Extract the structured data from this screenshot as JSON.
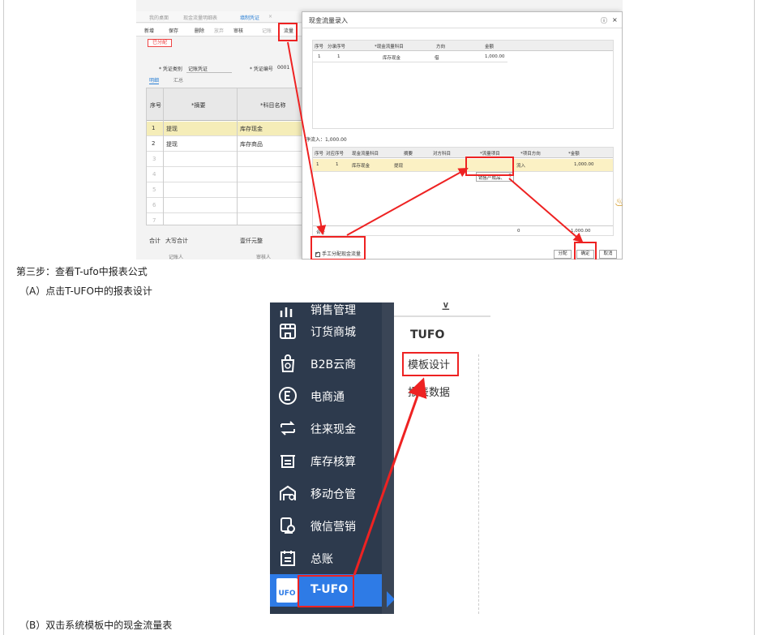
{
  "step3": "第三步：查看T-ufo中报表公式",
  "stepA": "（A）点击T-UFO中的报表设计",
  "stepB": "（B）双击系统模板中的现金流量表",
  "shot1": {
    "tabs": [
      "我的桌面",
      "现金流量明细表",
      "填制凭证"
    ],
    "toolbar": [
      "新增",
      "保存",
      "删除",
      "放弃",
      "审核",
      "记账",
      "流量"
    ],
    "tag": "已分配",
    "voucher_type_label": "* 凭证类别",
    "voucher_type_value": "记账凭证",
    "voucher_no_label": "* 凭证编号",
    "voucher_no_value": "0001",
    "subtabs": [
      "明细",
      "汇总"
    ],
    "table_headers": [
      "序号",
      "*摘要",
      "*科目名称"
    ],
    "rows": [
      {
        "no": "1",
        "summary": "提现",
        "account": "库存现金"
      },
      {
        "no": "2",
        "summary": "提现",
        "account": "库存商品"
      }
    ],
    "empty_rows": [
      "3",
      "4",
      "5",
      "6",
      "7"
    ],
    "footer": {
      "total": "合计",
      "caps_total": "大写合计",
      "caps_value": "壹仟元整",
      "bookkeeper": "记账人",
      "auditor": "审核人"
    },
    "modal": {
      "title": "现金流量录入",
      "help_icon": "?",
      "close_icon": "×",
      "table1_headers": [
        "序号",
        "分录序号",
        "*现金流量科目",
        "方向",
        "金额"
      ],
      "table1_row": {
        "no": "1",
        "entry": "1",
        "account": "库存现金",
        "dir": "借",
        "amount": "1,000.00"
      },
      "net_flow_label": "净流入：",
      "net_flow_value": "1,000.00",
      "table2_headers": [
        "序号",
        "对应序号",
        "现金流量科目",
        "摘要",
        "对方科目",
        "*流量项目",
        "*项目方向",
        "*金额"
      ],
      "table2_row": {
        "no": "1",
        "entry": "1",
        "account": "库存现金",
        "summary": "提现",
        "opp": "",
        "item": "销售产成品、",
        "dir": "流入",
        "amount": "1,000.00"
      },
      "sum_label": "合计",
      "sum_mid": "0",
      "sum_amount": "1,000.00",
      "manual_checkbox": "手工分配现金流量",
      "btn_allocate": "分配",
      "btn_ok": "确定",
      "btn_cancel": "取消"
    }
  },
  "shot2": {
    "nav": [
      {
        "label": "销售管理",
        "icon": "sales-icon"
      },
      {
        "label": "订货商城",
        "icon": "store-icon"
      },
      {
        "label": "B2B云商",
        "icon": "shopping-bag-icon"
      },
      {
        "label": "电商通",
        "icon": "ecommerce-icon"
      },
      {
        "label": "往来现金",
        "icon": "cash-flow-icon"
      },
      {
        "label": "库存核算",
        "icon": "inventory-icon"
      },
      {
        "label": "移动仓管",
        "icon": "warehouse-icon"
      },
      {
        "label": "微信营销",
        "icon": "wechat-marketing-icon"
      },
      {
        "label": "总账",
        "icon": "ledger-icon"
      },
      {
        "label": "T-UFO",
        "icon": "tufo-icon"
      }
    ],
    "tufo_badge": "UFO",
    "pane_title": "TUFO",
    "link_template": "模板设计",
    "link_data": "报表数据"
  },
  "colors": {
    "accent_blue": "#2e7be6",
    "annotation_red": "#e22222",
    "sidebar": "#2d3a4d"
  }
}
